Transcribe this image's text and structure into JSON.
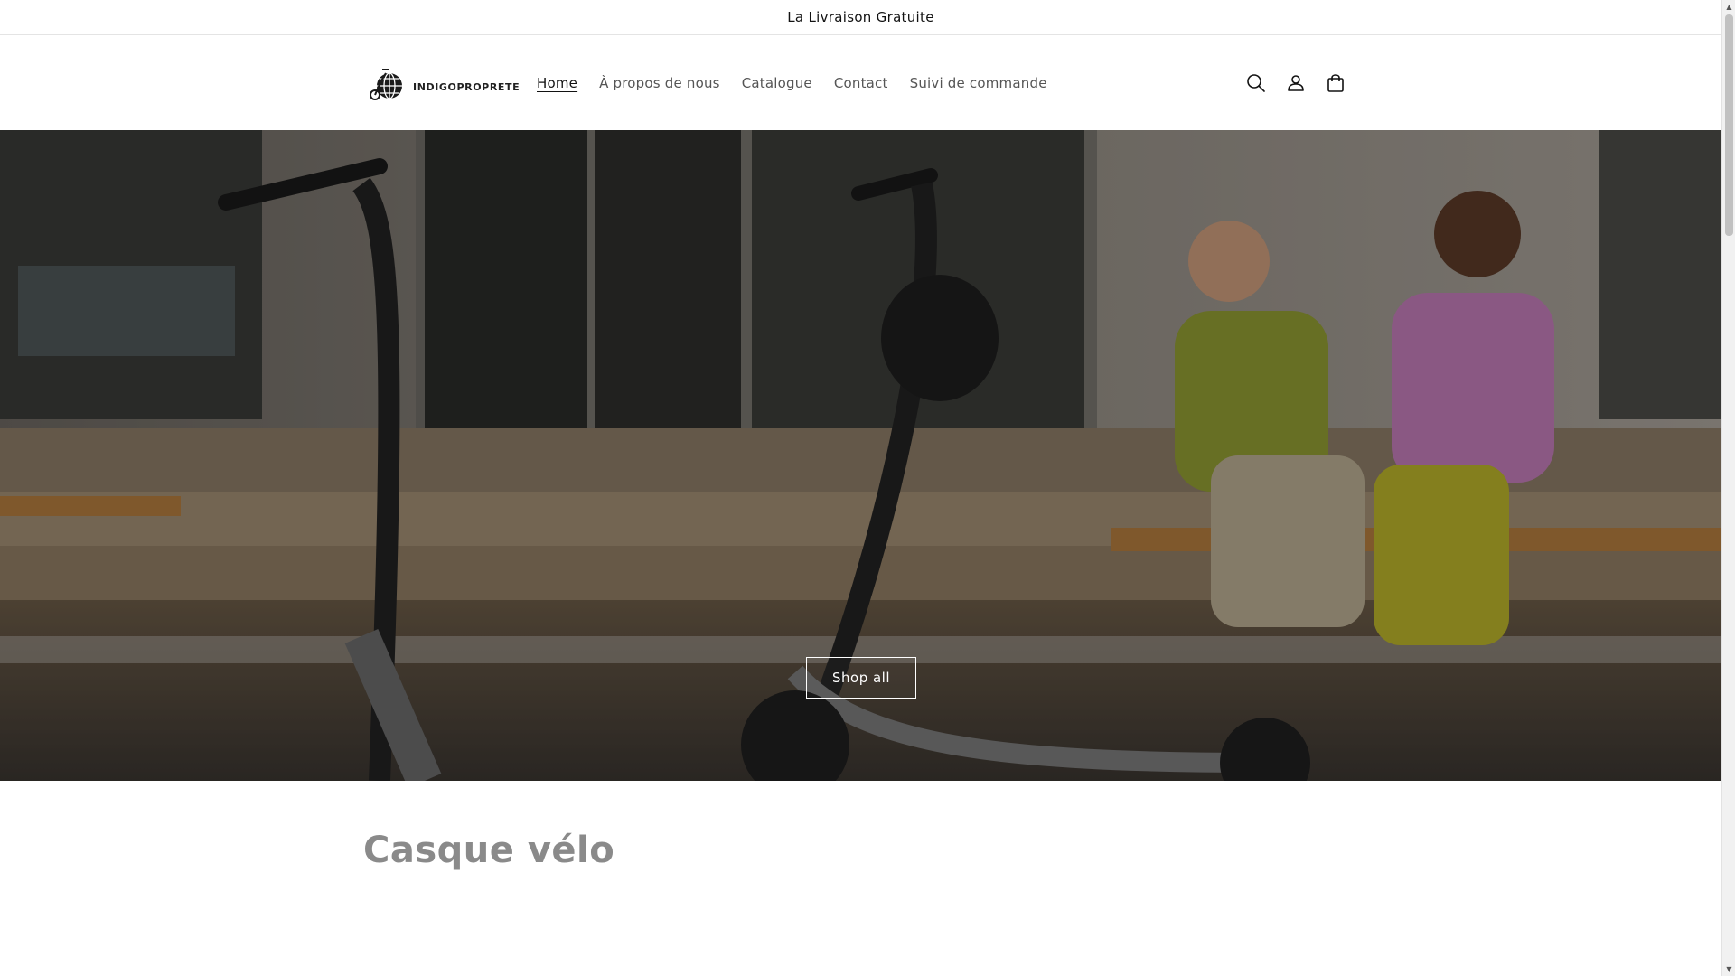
{
  "announcement": {
    "text": "La Livraison Gratuite"
  },
  "header": {
    "logo_text": "INDIGOPROPRETE",
    "nav": [
      {
        "label": "Home",
        "active": true
      },
      {
        "label": "À propos de nous",
        "active": false
      },
      {
        "label": "Catalogue",
        "active": false
      },
      {
        "label": "Contact",
        "active": false
      },
      {
        "label": "Suivi de commande",
        "active": false
      }
    ],
    "icons": [
      "search-icon",
      "account-icon",
      "cart-icon"
    ]
  },
  "hero": {
    "button_label": "Shop all"
  },
  "section": {
    "title": "Casque vélo"
  },
  "colors": {
    "text": "#121212",
    "muted_text": "#555555",
    "section_title": "#8a8a8a",
    "border": "#e4e4e4"
  }
}
